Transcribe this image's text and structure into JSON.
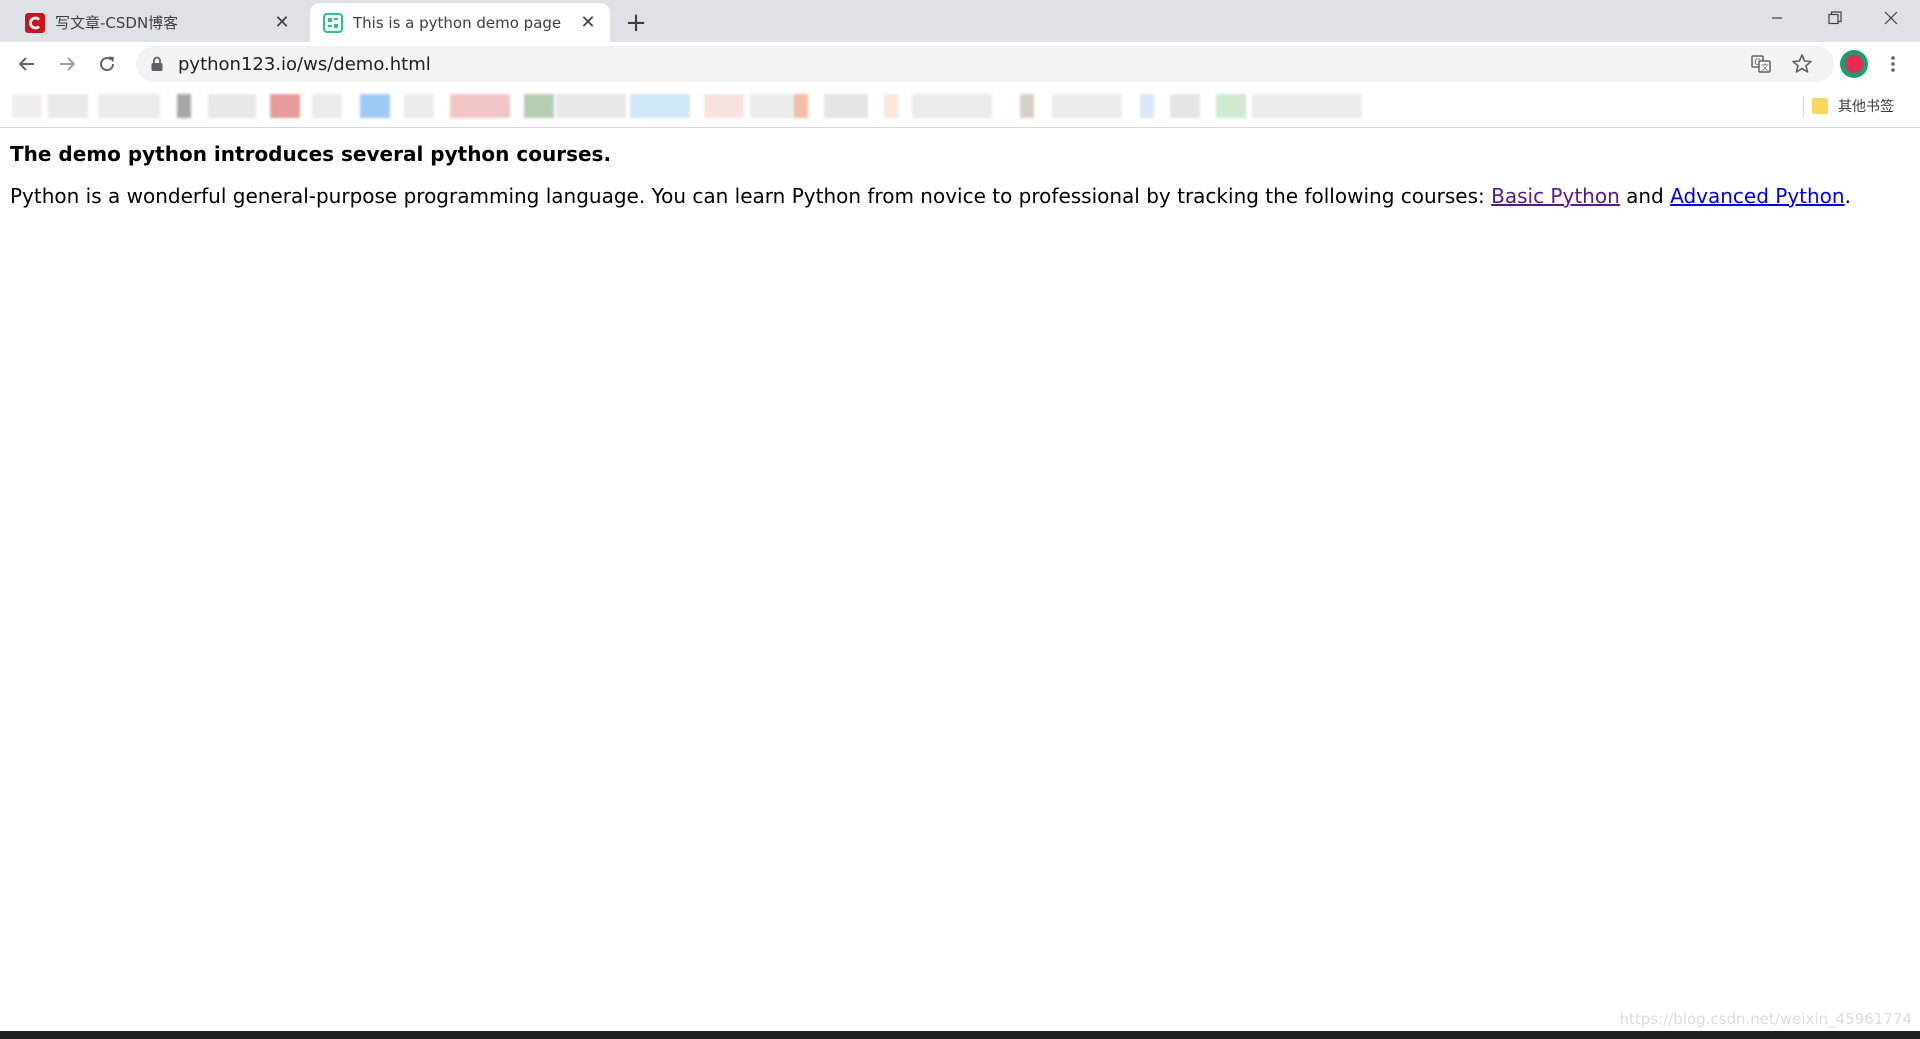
{
  "tabs": [
    {
      "title": "写文章-CSDN博客",
      "favicon": "csdn-logo-icon",
      "active": false
    },
    {
      "title": "This is a python demo page",
      "favicon": "python123-logo-icon",
      "active": true
    }
  ],
  "window_controls": {
    "minimize": "minimize-icon",
    "maximize": "restore-icon",
    "close": "close-icon"
  },
  "toolbar": {
    "url": "python123.io/ws/demo.html"
  },
  "bookmarks_bar": {
    "other_bookmarks_label": "其他书签"
  },
  "page": {
    "heading": "The demo python introduces several python courses.",
    "paragraph_text": "Python is a wonderful general-purpose programming language. You can learn Python from novice to professional by tracking the following courses: ",
    "link1": "Basic Python",
    "conjunction": " and ",
    "link2": "Advanced Python",
    "period": "."
  },
  "watermark": "https://blog.csdn.net/weixin_45961774",
  "colors": {
    "tabstrip": "#dee1e6",
    "omnibox": "#f1f3f4",
    "link_visited": "#551a8b",
    "link": "#0000ee"
  }
}
